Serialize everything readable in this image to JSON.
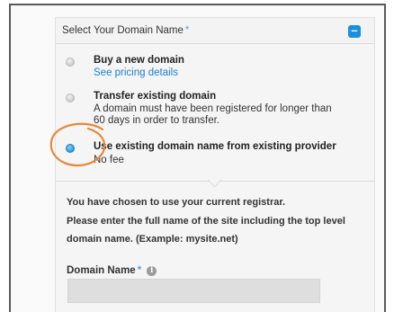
{
  "panel": {
    "title": "Select Your Domain Name",
    "required_mark": "*",
    "collapse_symbol": "–",
    "accent_color": "#1a8fdc"
  },
  "options": [
    {
      "title": "Buy a new domain",
      "link": "See pricing details",
      "checked": false
    },
    {
      "title": "Transfer existing domain",
      "description_line1": "A domain must have been registered for longer than",
      "description_line2": "60 days in order to transfer.",
      "checked": false
    },
    {
      "title": "Use existing domain name from existing provider",
      "description": "No fee",
      "checked": true
    }
  ],
  "info": {
    "line1": "You have chosen to use your current registrar.",
    "line2": "Please enter the full name of the site including the top level",
    "line3": "domain name. (Example: mysite.net)"
  },
  "domain_field": {
    "label": "Domain Name",
    "required_mark": "*",
    "info_icon": "i",
    "value": "",
    "placeholder": ""
  },
  "annotation": {
    "shape": "circle-highlight",
    "color": "#e8873a"
  }
}
